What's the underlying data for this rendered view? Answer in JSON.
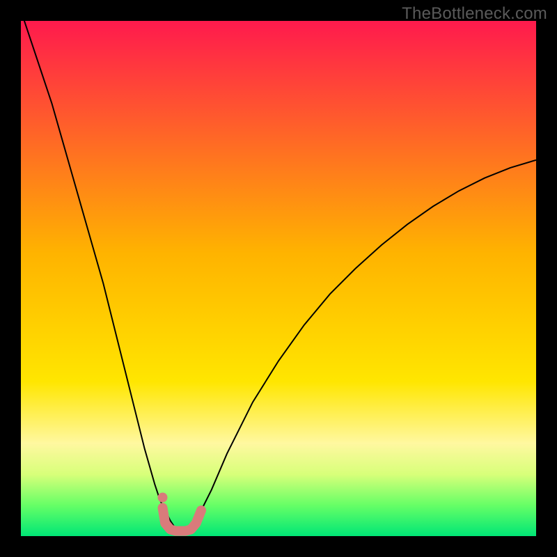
{
  "watermark": "TheBottleneck.com",
  "chart_data": {
    "type": "line",
    "title": "",
    "xlabel": "",
    "ylabel": "",
    "xlim": [
      0,
      100
    ],
    "ylim": [
      0,
      100
    ],
    "background_gradient": {
      "stops": [
        {
          "offset": 0.0,
          "color": "#ff1a4d"
        },
        {
          "offset": 0.45,
          "color": "#ffb300"
        },
        {
          "offset": 0.7,
          "color": "#ffe600"
        },
        {
          "offset": 0.82,
          "color": "#fff8a0"
        },
        {
          "offset": 0.88,
          "color": "#d8ff7a"
        },
        {
          "offset": 0.94,
          "color": "#66ff66"
        },
        {
          "offset": 1.0,
          "color": "#00e676"
        }
      ]
    },
    "series": [
      {
        "name": "bottleneck-curve",
        "color": "#000000",
        "stroke_width": 2,
        "x": [
          0,
          2,
          4,
          6,
          8,
          10,
          12,
          14,
          16,
          18,
          20,
          22,
          24,
          26,
          27,
          28,
          29,
          30,
          31,
          32,
          33,
          34,
          35,
          37,
          40,
          45,
          50,
          55,
          60,
          65,
          70,
          75,
          80,
          85,
          90,
          95,
          100
        ],
        "y": [
          102,
          96,
          90,
          84,
          77,
          70,
          63,
          56,
          49,
          41,
          33,
          25,
          17,
          10,
          7,
          5,
          3,
          1.5,
          1,
          1,
          1.5,
          3,
          5,
          9,
          16,
          26,
          34,
          41,
          47,
          52,
          56.5,
          60.5,
          64,
          67,
          69.5,
          71.5,
          73
        ]
      },
      {
        "name": "optimal-range-highlight",
        "color": "#d97b7b",
        "stroke_width": 14,
        "linecap": "round",
        "x": [
          27.5,
          28,
          29,
          30,
          31,
          32,
          33,
          34,
          35
        ],
        "y": [
          5.5,
          2.5,
          1.3,
          1,
          1,
          1,
          1.3,
          2.5,
          5
        ]
      }
    ],
    "markers": [
      {
        "name": "left-dot",
        "x": 27.5,
        "y": 7.5,
        "r": 7,
        "color": "#d97b7b"
      }
    ]
  }
}
